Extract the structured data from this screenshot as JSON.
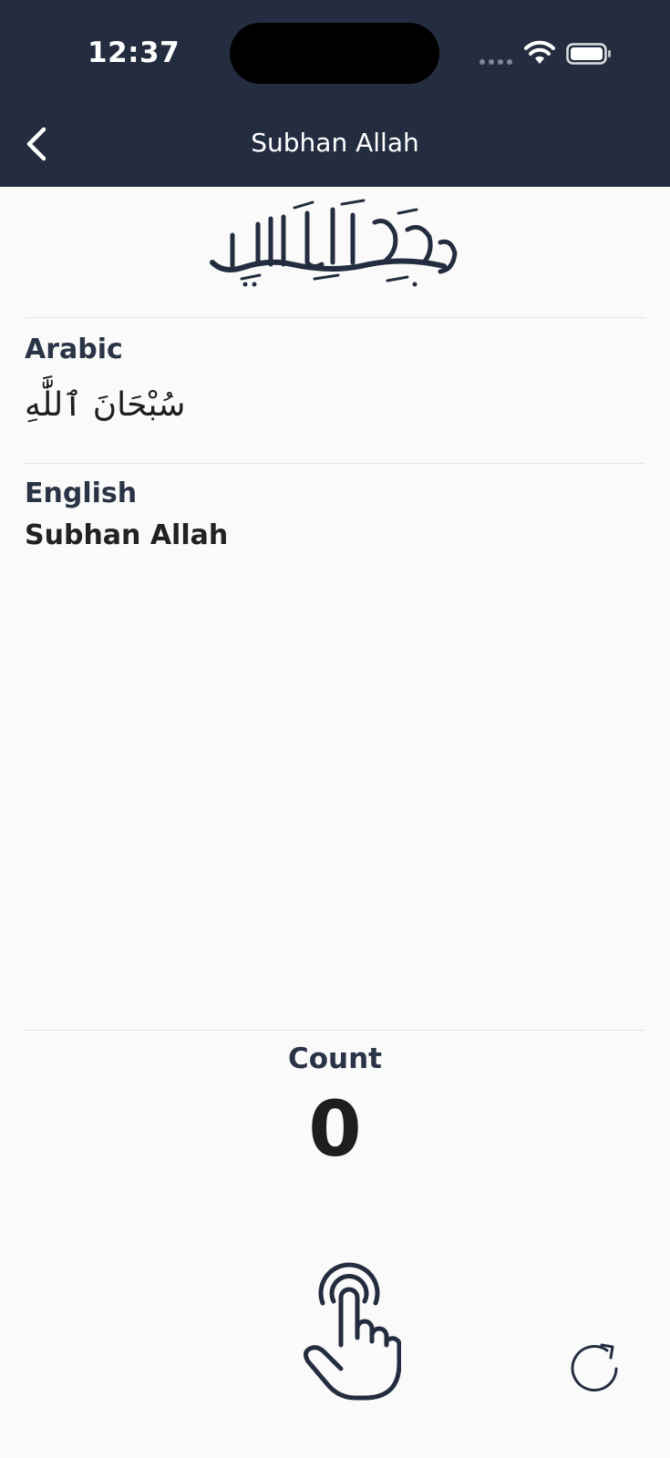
{
  "status_bar": {
    "time": "12:37"
  },
  "nav": {
    "title": "Subhan Allah"
  },
  "sections": {
    "arabic_label": "Arabic",
    "arabic_text": "سُبْحَانَ ٱللَّٰهِ",
    "english_label": "English",
    "english_text": "Subhan Allah"
  },
  "counter": {
    "label": "Count",
    "value": "0"
  },
  "colors": {
    "header_bg": "#232d3f",
    "page_bg": "#fafafa",
    "ink": "#1e2433"
  },
  "icons": {
    "back": "chevron-left-icon",
    "tap": "tap-hand-icon",
    "reset": "reset-icon",
    "bismillah": "bismillah-calligraphy-icon"
  }
}
